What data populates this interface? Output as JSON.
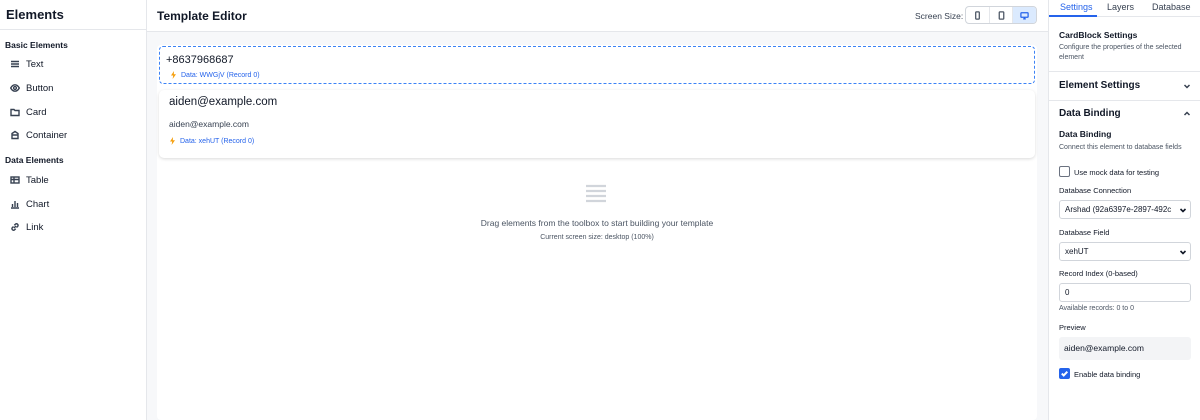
{
  "sidebar": {
    "title": "Elements",
    "basic_title": "Basic Elements",
    "basic_items": [
      {
        "label": "Text",
        "icon": "text-lines-icon"
      },
      {
        "label": "Button",
        "icon": "eye-icon"
      },
      {
        "label": "Card",
        "icon": "folder-icon"
      },
      {
        "label": "Container",
        "icon": "box-icon"
      }
    ],
    "data_title": "Data Elements",
    "data_items": [
      {
        "label": "Table",
        "icon": "table-icon"
      },
      {
        "label": "Chart",
        "icon": "bar-chart-icon"
      },
      {
        "label": "Link",
        "icon": "link-icon"
      }
    ]
  },
  "editor": {
    "title": "Template Editor",
    "screen_size_label": "Screen Size:",
    "screen_size_active": "desktop",
    "selected_block": {
      "value": "+8637968687",
      "binding": "Data: WWGjV (Record 0)"
    },
    "card_block": {
      "title": "aiden@example.com",
      "subtitle": "aiden@example.com",
      "binding": "Data: xehUT (Record 0)"
    },
    "empty_text": "Drag elements from the toolbox to start building your template",
    "empty_sub": "Current screen size: desktop (100%)"
  },
  "panel": {
    "tabs": [
      "Settings",
      "Layers",
      "Database"
    ],
    "active_tab": "Settings",
    "heading": "CardBlock Settings",
    "description": "Configure the properties of the selected element",
    "element_settings": "Element Settings",
    "data_binding": "Data Binding",
    "data_binding_sub": "Data Binding",
    "data_binding_desc": "Connect this element to database fields",
    "mock_label": "Use mock data for testing",
    "mock_checked": false,
    "db_connection_label": "Database Connection",
    "db_connection_value": "Arshad (92a6397e-2897-492c",
    "db_field_label": "Database Field",
    "db_field_value": "xehUT",
    "record_index_label": "Record Index (0-based)",
    "record_index_value": "0",
    "available_records": "Available records: 0 to 0",
    "preview_label": "Preview",
    "preview_value": "aiden@example.com",
    "enable_label": "Enable data binding",
    "enable_checked": true,
    "colors": {
      "accent": "#2563eb",
      "selection_border": "#3b82f6",
      "bolt": "#f59e0b"
    }
  }
}
